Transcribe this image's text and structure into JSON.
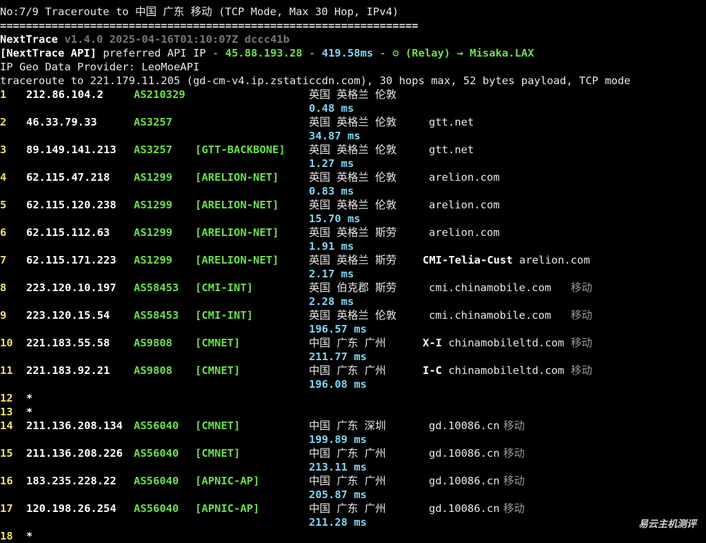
{
  "header": {
    "title": "No:7/9 Traceroute to 中国 广东 移动 (TCP Mode, Max 30 Hop, IPv4)",
    "separator": "=================================================================",
    "app_name": "NextTrace",
    "app_version": " v1.4.0 2025-04-16T01:10:07Z dccc41b",
    "api_label": "[NextTrace API]",
    "api_text": " preferred API IP - ",
    "api_ip": "45.88.193.28",
    "api_dash": " - ",
    "api_latency": "419.58ms",
    "api_dash2": " - ",
    "api_relay": "⚙ (Relay) → Misaka.LAX",
    "geo_provider": "IP Geo Data Provider: LeoMoeAPI",
    "traceroute_line": "traceroute to 221.179.11.205 (gd-cm-v4.ip.zstaticcdn.com), 30 hops max, 52 bytes payload, TCP mode"
  },
  "hops": [
    {
      "n": "1",
      "ip": "212.86.104.2",
      "asn": "AS210329",
      "tag": "",
      "geo": "英国 英格兰 伦敦",
      "host": "",
      "isp": "",
      "ms": "0.48 ms"
    },
    {
      "n": "2",
      "ip": "46.33.79.33",
      "asn": "AS3257",
      "tag": "",
      "geo": "英国 英格兰 伦敦",
      "host": "gtt.net",
      "isp": "",
      "ms": "34.87 ms"
    },
    {
      "n": "3",
      "ip": "89.149.141.213",
      "asn": "AS3257",
      "tag": "[GTT-BACKBONE]",
      "geo": "英国 英格兰 伦敦",
      "host": "gtt.net",
      "isp": "",
      "ms": "1.27 ms"
    },
    {
      "n": "4",
      "ip": "62.115.47.218",
      "asn": "AS1299",
      "tag": "[ARELION-NET]",
      "geo": "英国 英格兰 伦敦",
      "host": "arelion.com",
      "isp": "",
      "ms": "0.83 ms"
    },
    {
      "n": "5",
      "ip": "62.115.120.238",
      "asn": "AS1299",
      "tag": "[ARELION-NET]",
      "geo": "英国 英格兰 伦敦",
      "host": "arelion.com",
      "isp": "",
      "ms": "15.70 ms"
    },
    {
      "n": "6",
      "ip": "62.115.112.63",
      "asn": "AS1299",
      "tag": "[ARELION-NET]",
      "geo": "英国 英格兰 斯劳",
      "host": "arelion.com",
      "isp": "",
      "ms": "1.91 ms"
    },
    {
      "n": "7",
      "ip": "62.115.171.223",
      "asn": "AS1299",
      "tag": "[ARELION-NET]",
      "geo": "英国 英格兰 斯劳",
      "host_bold": "CMI-Telia-Cust",
      "host": "arelion.com",
      "isp": "",
      "ms": "2.17 ms"
    },
    {
      "n": "8",
      "ip": "223.120.10.197",
      "asn": "AS58453",
      "tag": "[CMI-INT]",
      "geo": "英国 伯克郡 斯劳",
      "host": "cmi.chinamobile.com",
      "isp": "移动",
      "ms": "2.28 ms"
    },
    {
      "n": "9",
      "ip": "223.120.15.54",
      "asn": "AS58453",
      "tag": "[CMI-INT]",
      "geo": "英国 英格兰 伦敦",
      "host": "cmi.chinamobile.com",
      "isp": "移动",
      "ms": "196.57 ms"
    },
    {
      "n": "10",
      "ip": "221.183.55.58",
      "asn": "AS9808",
      "tag": "[CMNET]",
      "geo": "中国 广东 广州",
      "host_bold": "X-I",
      "host": "chinamobileltd.com",
      "isp": "移动",
      "ms": "211.77 ms"
    },
    {
      "n": "11",
      "ip": "221.183.92.21",
      "asn": "AS9808",
      "tag": "[CMNET]",
      "geo": "中国 广东 广州",
      "host_bold": "I-C",
      "host": "chinamobileltd.com",
      "isp": "移动",
      "ms": "196.08 ms"
    },
    {
      "n": "12",
      "star": "*"
    },
    {
      "n": "13",
      "star": "*"
    },
    {
      "n": "14",
      "ip": "211.136.208.134",
      "asn": "AS56040",
      "tag": "[CMNET]",
      "geo": "中国 广东 深圳",
      "host": "gd.10086.cn",
      "isp": "移动",
      "ms": "199.89 ms"
    },
    {
      "n": "15",
      "ip": "211.136.208.226",
      "asn": "AS56040",
      "tag": "[CMNET]",
      "geo": "中国 广东 广州",
      "host": "gd.10086.cn",
      "isp": "移动",
      "ms": "213.11 ms"
    },
    {
      "n": "16",
      "ip": "183.235.228.22",
      "asn": "AS56040",
      "tag": "[APNIC-AP]",
      "geo": "中国 广东 广州",
      "host": "gd.10086.cn",
      "isp": "移动",
      "ms": "205.87 ms"
    },
    {
      "n": "17",
      "ip": "120.198.26.254",
      "asn": "AS56040",
      "tag": "[APNIC-AP]",
      "geo": "中国 广东 广州",
      "host": "gd.10086.cn",
      "isp": "移动",
      "ms": "211.28 ms"
    },
    {
      "n": "18",
      "star": "*"
    }
  ],
  "watermark": "易云主机测评"
}
